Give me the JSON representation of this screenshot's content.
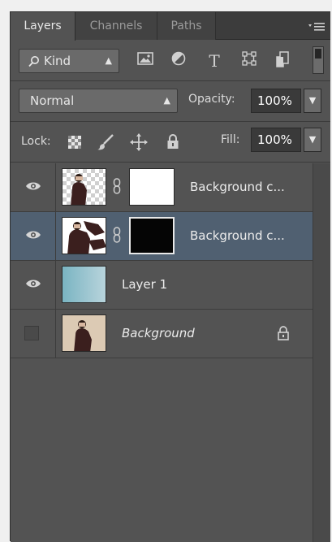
{
  "tabs": [
    {
      "label": "Layers",
      "active": true
    },
    {
      "label": "Channels",
      "active": false
    },
    {
      "label": "Paths",
      "active": false
    }
  ],
  "filter": {
    "kind_label": "Kind",
    "icons": [
      "image-filter-icon",
      "adjustment-filter-icon",
      "type-filter-icon",
      "shape-filter-icon",
      "smart-object-filter-icon"
    ]
  },
  "blend": {
    "mode": "Normal",
    "opacity_label": "Opacity:",
    "opacity_value": "100%"
  },
  "lock": {
    "label": "Lock:",
    "fill_label": "Fill:",
    "fill_value": "100%"
  },
  "layers": [
    {
      "name": "Background c...",
      "visible": true,
      "selected": false,
      "thumb": "figure-transparent",
      "mask": "white"
    },
    {
      "name": "Background c...",
      "visible": true,
      "selected": true,
      "thumb": "figure-hands",
      "mask": "black"
    },
    {
      "name": "Layer 1",
      "visible": true,
      "selected": false,
      "thumb": "gradient"
    },
    {
      "name": "Background",
      "visible": false,
      "selected": false,
      "thumb": "photo",
      "locked": true
    }
  ],
  "colors": {
    "panel_bg": "#535353",
    "selected_row": "#506071",
    "tab_bar": "#3c3c3c"
  }
}
